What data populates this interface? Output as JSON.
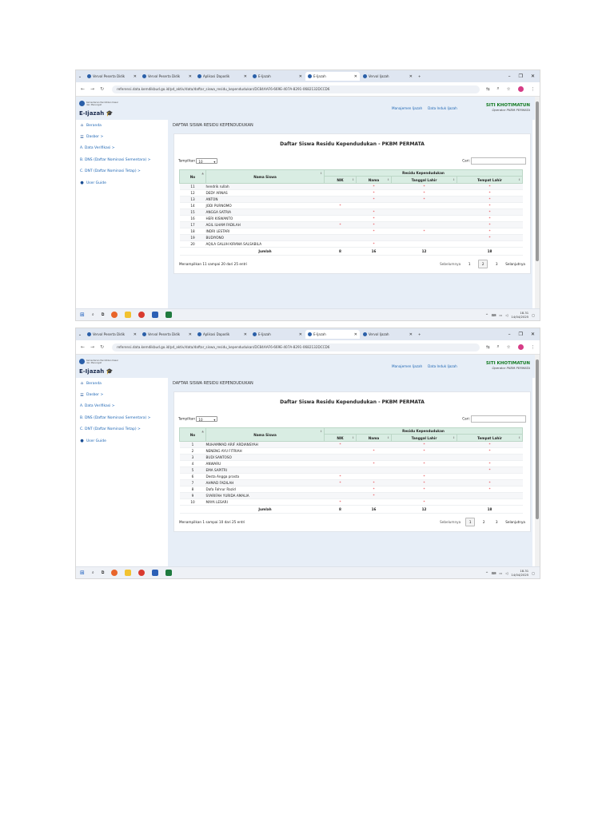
{
  "browser": {
    "tabs": [
      {
        "label": "Verval Peserta Didik",
        "active": false
      },
      {
        "label": "Verval Peserta Didik",
        "active": false
      },
      {
        "label": "Aplikasi Dapodik",
        "active": false
      },
      {
        "label": "E-Ijazah",
        "active": false
      },
      {
        "label": "E-Ijazah",
        "active": true
      },
      {
        "label": "Verval Ijazah",
        "active": false
      }
    ],
    "url": "referensi.data.kemdikbud.go.id/pd_aktiv/data/daftar_siswa_residu_kependudukan/DC84AAF6-669E-407A-8291-0682132DCCD6"
  },
  "app": {
    "ministry": "Kementerian Pendidikan Dasar dan Menengah",
    "brand": "E-Ijazah",
    "header_links": [
      "Manajemen Ijazah",
      "Data Induk Ijazah"
    ],
    "user_name": "SITI KHOTIMATUN",
    "user_role": "Operator PKBM PERMATA"
  },
  "sidebar": {
    "items": [
      {
        "label": "Beranda",
        "icon": "home-icon"
      },
      {
        "label": "Dasbor >",
        "icon": "list-icon"
      },
      {
        "label": "A. Data Verifikasi >",
        "icon": ""
      },
      {
        "label": "B. DNS (Daftar Nominasi Sementara) >",
        "icon": ""
      },
      {
        "label": "C. DNT (Daftar Nominasi Tetap) >",
        "icon": ""
      },
      {
        "label": "User Guide",
        "icon": "help-icon"
      }
    ]
  },
  "page": {
    "breadcrumb_title": "DAFTAR SISWA RESIDU KEPENDUDUKAN",
    "card_title": "Daftar Siswa Residu Kependudukan - PKBM PERMATA",
    "show_label": "Tampilkan",
    "show_value": "10",
    "search_label": "Cari:",
    "col_no": "No",
    "col_name": "Nama Siswa",
    "col_group": "Residu Kependudukan",
    "col_nik": "NIK",
    "col_nama": "Nama",
    "col_tgl": "Tanggal Lahir",
    "col_tempat": "Tempat Lahir",
    "total_label": "Jumlah",
    "totals": {
      "nik": "8",
      "nama": "16",
      "tgl": "12",
      "tempat": "18"
    },
    "prev_label": "Sebelumnya",
    "next_label": "Selanjutnya",
    "pages": [
      "1",
      "2",
      "3"
    ]
  },
  "screens": [
    {
      "info": "Menampilkan 11 sampai 20 dari 25 entri",
      "current_page": "2",
      "rows": [
        {
          "no": "11",
          "name": "hendrik rullah",
          "nik": "",
          "nama": "*",
          "tgl": "*",
          "tempat": "*"
        },
        {
          "no": "12",
          "name": "DEDY ARNAS",
          "nik": "",
          "nama": "*",
          "tgl": "*",
          "tempat": "*"
        },
        {
          "no": "13",
          "name": "ANTON",
          "nik": "",
          "nama": "*",
          "tgl": "*",
          "tempat": "*"
        },
        {
          "no": "14",
          "name": "JODI PURNOMO",
          "nik": "*",
          "nama": "",
          "tgl": "",
          "tempat": "*"
        },
        {
          "no": "15",
          "name": "ANGGA SATRIA",
          "nik": "",
          "nama": "*",
          "tgl": "",
          "tempat": "*"
        },
        {
          "no": "16",
          "name": "HERI KISWANTO",
          "nik": "",
          "nama": "*",
          "tgl": "",
          "tempat": "*"
        },
        {
          "no": "17",
          "name": "AGIL ILHAM FADILAH",
          "nik": "*",
          "nama": "*",
          "tgl": "",
          "tempat": "*"
        },
        {
          "no": "18",
          "name": "INDRI LESTARI",
          "nik": "",
          "nama": "*",
          "tgl": "*",
          "tempat": "*"
        },
        {
          "no": "19",
          "name": "BUDIYONO",
          "nik": "",
          "nama": "",
          "tgl": "",
          "tempat": "*"
        },
        {
          "no": "20",
          "name": "AQILA GALUH KIRANA SALSABILA",
          "nik": "",
          "nama": "*",
          "tgl": "",
          "tempat": ""
        }
      ]
    },
    {
      "info": "Menampilkan 1 sampai 10 dari 25 entri",
      "current_page": "1",
      "rows": [
        {
          "no": "1",
          "name": "MUHAMMAD ARIF ARDIANSYAH",
          "nik": "*",
          "nama": "",
          "tgl": "*",
          "tempat": "*"
        },
        {
          "no": "2",
          "name": "NENENG AYU FITRIAH",
          "nik": "",
          "nama": "*",
          "tgl": "*",
          "tempat": "*"
        },
        {
          "no": "3",
          "name": "BUDI SANTOSO",
          "nik": "",
          "nama": "",
          "tgl": "",
          "tempat": ""
        },
        {
          "no": "4",
          "name": "ANWARU",
          "nik": "",
          "nama": "*",
          "tgl": "*",
          "tempat": "*"
        },
        {
          "no": "5",
          "name": "EMA SAPITRI",
          "nik": "",
          "nama": "",
          "tgl": "",
          "tempat": "*"
        },
        {
          "no": "6",
          "name": "Desta Angga prasta",
          "nik": "*",
          "nama": "",
          "tgl": "*",
          "tempat": ""
        },
        {
          "no": "7",
          "name": "AHMAD FADILAH",
          "nik": "*",
          "nama": "*",
          "tgl": "*",
          "tempat": "*"
        },
        {
          "no": "8",
          "name": "Dafa Fahrur Razid",
          "nik": "",
          "nama": "*",
          "tgl": "*",
          "tempat": "*"
        },
        {
          "no": "9",
          "name": "SYARIFAH YURIDA AMALIA",
          "nik": "",
          "nama": "*",
          "tgl": "",
          "tempat": ""
        },
        {
          "no": "10",
          "name": "MAYA LESARI",
          "nik": "*",
          "nama": "",
          "tgl": "*",
          "tempat": ""
        }
      ]
    }
  ],
  "taskbar": {
    "time": "18.31",
    "date": "14/04/2025"
  }
}
